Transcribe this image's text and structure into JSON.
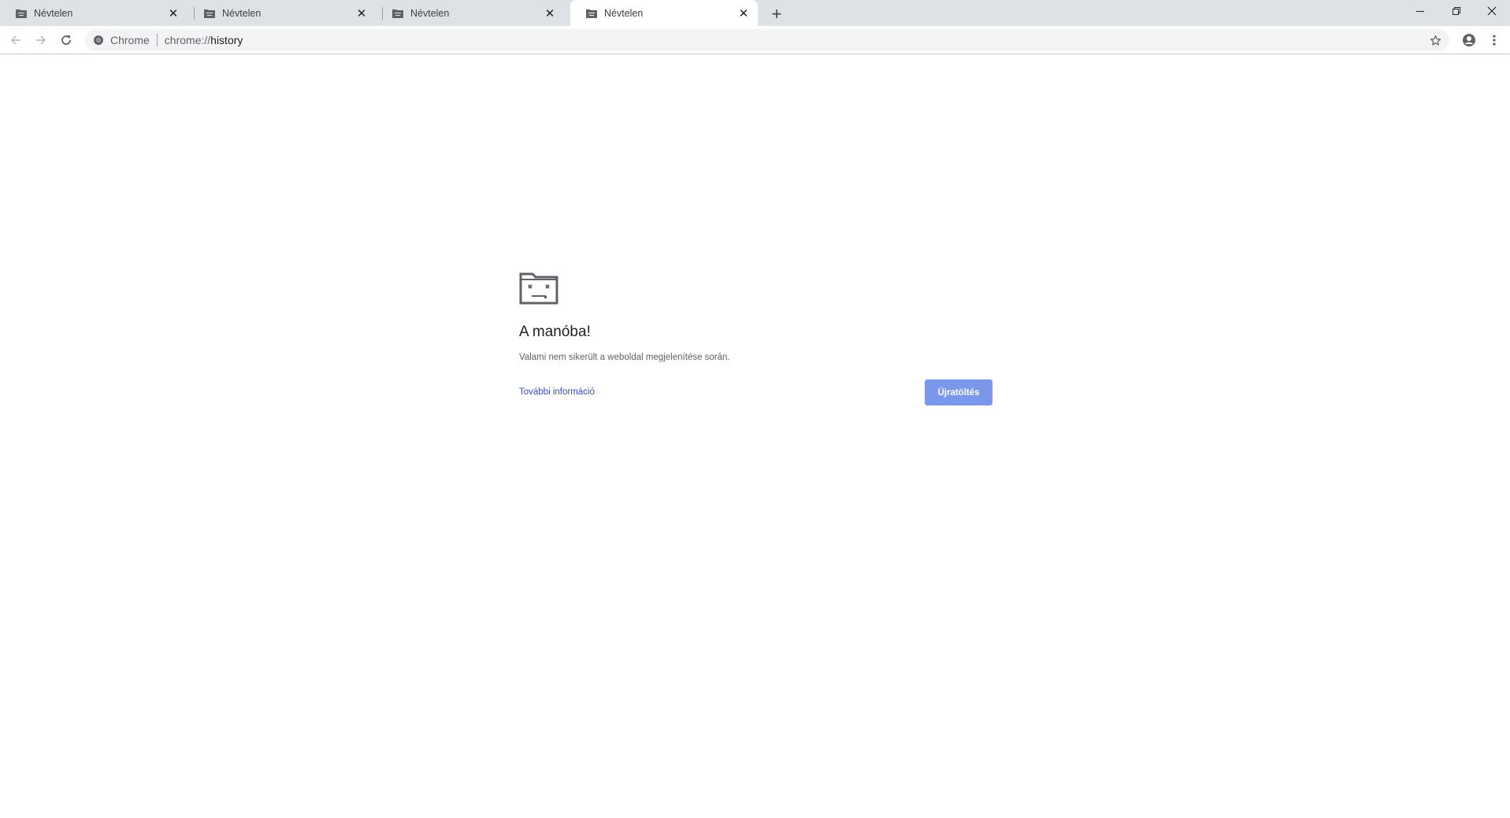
{
  "tabs": [
    {
      "title": "Névtelen",
      "active": false
    },
    {
      "title": "Névtelen",
      "active": false
    },
    {
      "title": "Névtelen",
      "active": false
    },
    {
      "title": "Névtelen",
      "active": true
    }
  ],
  "icons": {
    "tab_favicon": "sad-folder-icon",
    "close": "close-icon",
    "new_tab": "plus-icon",
    "back": "back-arrow-icon",
    "forward": "forward-arrow-icon",
    "reload": "reload-icon",
    "secure": "chrome-icon",
    "bookmark": "star-icon",
    "profile": "profile-icon",
    "menu": "kebab-menu-icon",
    "minimize": "minimize-icon",
    "restore": "restore-icon",
    "window_close": "window-close-icon"
  },
  "omnibox": {
    "chip": "Chrome",
    "scheme": "chrome://",
    "path": "history"
  },
  "error_page": {
    "heading": "A manóba!",
    "message": "Valami nem sikerült a weboldal megjelenítése során.",
    "more_info_link": "További információ",
    "reload_button": "Újratöltés"
  },
  "colors": {
    "tabstrip_bg": "#dee1e6",
    "omnibox_bg": "#f1f3f4",
    "link": "#3c4bbf",
    "button": "#7b97ec"
  }
}
